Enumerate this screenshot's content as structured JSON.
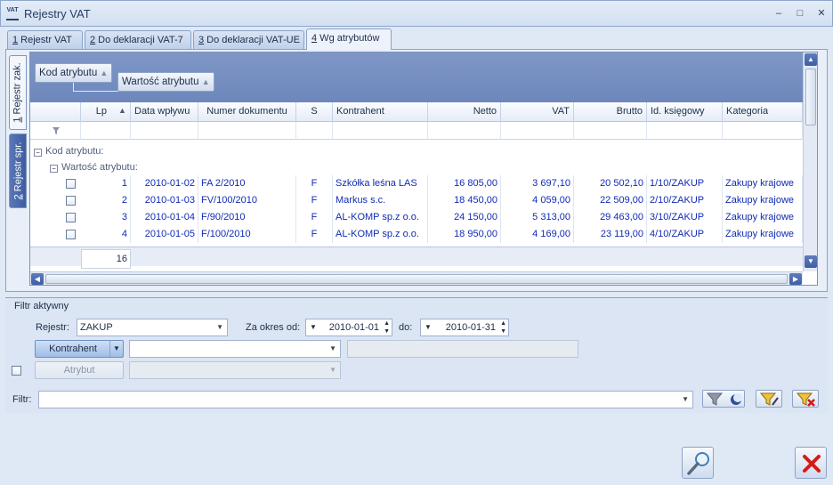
{
  "window": {
    "title": "Rejestry VAT",
    "icon_text": "VAT",
    "minimize": "–",
    "maximize": "□",
    "close": "✕"
  },
  "tabs": [
    {
      "key": "1",
      "label": " Rejestr VAT"
    },
    {
      "key": "2",
      "label": " Do deklaracji VAT-7"
    },
    {
      "key": "3",
      "label": " Do deklaracji VAT-UE"
    },
    {
      "key": "4",
      "label": " Wg atrybutów"
    }
  ],
  "side_tabs": [
    {
      "key": "1",
      "label": " Rejestr zak."
    },
    {
      "key": "2",
      "label": " Rejestr spr."
    }
  ],
  "grid": {
    "group_chips": [
      {
        "label": "Kod atrybutu",
        "sort": "▲"
      },
      {
        "label": "Wartość atrybutu",
        "sort": "▲"
      }
    ],
    "columns": [
      "",
      "Lp",
      "Data wpływu",
      "Numer dokumentu",
      "S",
      "Kontrahent",
      "Netto",
      "VAT",
      "Brutto",
      "Id. księgowy",
      "Kategoria"
    ],
    "lp_sort": "▲",
    "group_levels": [
      "Kod atrybutu:",
      "Wartość atrybutu:"
    ],
    "rows": [
      {
        "lp": "1",
        "date": "2010-01-02",
        "doc": "FA 2/2010",
        "s": "F",
        "contractor": "Szkółka leśna LAS",
        "netto": "16 805,00",
        "vat": "3 697,10",
        "brutto": "20 502,10",
        "id": "1/10/ZAKUP",
        "category": "Zakupy krajowe"
      },
      {
        "lp": "2",
        "date": "2010-01-03",
        "doc": "FV/100/2010",
        "s": "F",
        "contractor": "Markus s.c.",
        "netto": "18 450,00",
        "vat": "4 059,00",
        "brutto": "22 509,00",
        "id": "2/10/ZAKUP",
        "category": "Zakupy krajowe"
      },
      {
        "lp": "3",
        "date": "2010-01-04",
        "doc": "F/90/2010",
        "s": "F",
        "contractor": "AL-KOMP sp.z o.o.",
        "netto": "24 150,00",
        "vat": "5 313,00",
        "brutto": "29 463,00",
        "id": "3/10/ZAKUP",
        "category": "Zakupy krajowe"
      },
      {
        "lp": "4",
        "date": "2010-01-05",
        "doc": "F/100/2010",
        "s": "F",
        "contractor": "AL-KOMP sp.z o.o.",
        "netto": "18 950,00",
        "vat": "4 169,00",
        "brutto": "23 119,00",
        "id": "4/10/ZAKUP",
        "category": "Zakupy krajowe"
      }
    ],
    "footer_count": "16"
  },
  "filter": {
    "section_title": "Filtr aktywny",
    "rejestr_label": "Rejestr:",
    "rejestr_value": "ZAKUP",
    "period_label": "Za okres od:",
    "date_from": "2010-01-01",
    "to_label": "do:",
    "date_to": "2010-01-31",
    "kontrahent_button": "Kontrahent",
    "atrybut_button": "Atrybut",
    "filtr_label": "Filtr:"
  }
}
